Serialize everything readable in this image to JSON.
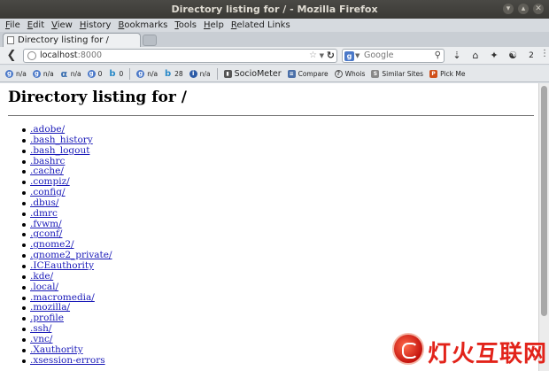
{
  "window": {
    "title": "Directory listing for / - Mozilla Firefox",
    "controls": [
      "▾",
      "▴",
      "✕"
    ]
  },
  "menubar": {
    "items": [
      "File",
      "Edit",
      "View",
      "History",
      "Bookmarks",
      "Tools",
      "Help",
      "Related Links"
    ]
  },
  "tabs": [
    {
      "label": "Directory listing for /"
    }
  ],
  "navbar": {
    "url_host": "localhost",
    "url_port": ":8000",
    "search_placeholder": "Google",
    "badge_count": "2"
  },
  "bookmarks": {
    "items": [
      {
        "label": "n/a",
        "icon": "google-g-icon",
        "color": "#4a78c8"
      },
      {
        "label": "n/a",
        "icon": "google-g-icon",
        "color": "#4a78c8"
      },
      {
        "label": "n/a",
        "icon": "alexa-icon",
        "color": "#3a6fb0"
      },
      {
        "label": "0",
        "icon": "google-g-icon",
        "color": "#4a78c8"
      },
      {
        "label": "0",
        "icon": "bing-icon",
        "color": "#2a8ac8"
      },
      {
        "label": "n/a",
        "icon": "google-g-icon",
        "color": "#4a78c8"
      },
      {
        "label": "28",
        "icon": "bing-icon",
        "color": "#2a8ac8"
      },
      {
        "label": "n/a",
        "icon": "info-icon",
        "color": "#2b5aa6"
      },
      {
        "label": "SocioMeter",
        "icon": "sociometer-icon",
        "color": "#555"
      },
      {
        "label": "Compare",
        "icon": "compare-icon",
        "color": "#4a6fa8"
      },
      {
        "label": "Whois",
        "icon": "whois-icon",
        "color": "#555"
      },
      {
        "label": "Similar Sites",
        "icon": "similar-sites-icon",
        "color": "#666"
      },
      {
        "label": "Pick Me",
        "icon": "pickme-icon",
        "color": "#d0501a"
      }
    ]
  },
  "page": {
    "heading": "Directory listing for /",
    "files": [
      ".adobe/",
      ".bash_history",
      ".bash_logout",
      ".bashrc",
      ".cache/",
      ".compiz/",
      ".config/",
      ".dbus/",
      ".dmrc",
      ".fvwm/",
      ".gconf/",
      ".gnome2/",
      ".gnome2_private/",
      ".ICEauthority",
      ".kde/",
      ".local/",
      ".macromedia/",
      ".mozilla/",
      ".profile",
      ".ssh/",
      ".vnc/",
      ".Xauthority",
      ".xsession-errors"
    ]
  },
  "watermark": {
    "text": "灯火互联网"
  }
}
